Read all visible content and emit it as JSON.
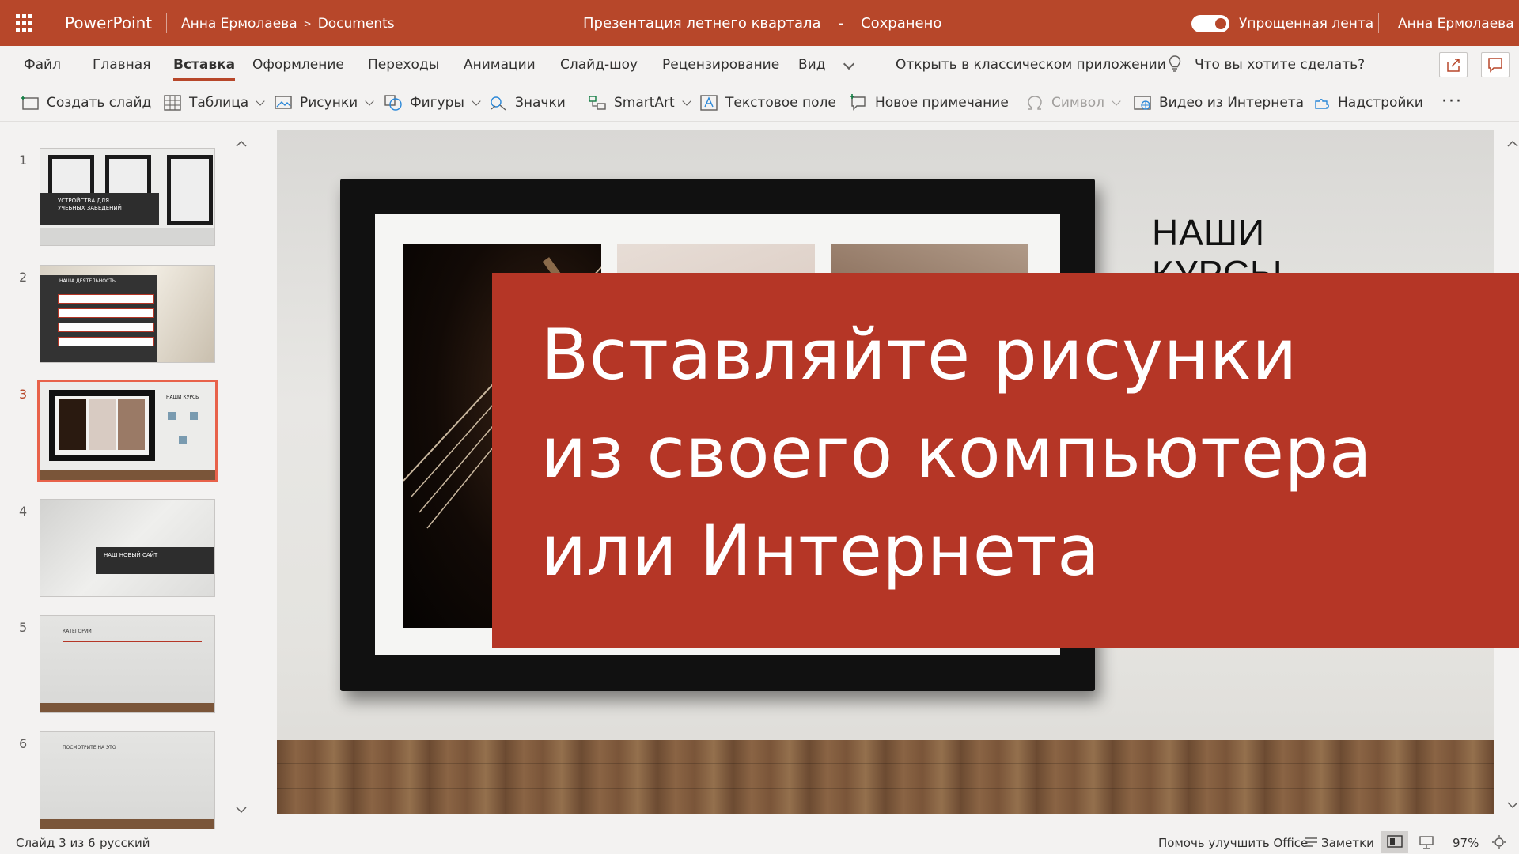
{
  "titlebar": {
    "app_name": "PowerPoint",
    "breadcrumb_user": "Анна Ермолаева",
    "breadcrumb_folder": "Documents",
    "doc_title": "Презентация летнего квартала",
    "doc_dash": "-",
    "save_status": "Сохранено",
    "toggle_label": "Упрощенная лента",
    "toggle_on": true,
    "user_name": "Анна Ермолаева"
  },
  "tabs": [
    "Файл",
    "Главная",
    "Вставка",
    "Оформление",
    "Переходы",
    "Анимации",
    "Слайд-шоу",
    "Рецензирование",
    "Вид"
  ],
  "active_tab": "Вставка",
  "open_desktop": "Открыть в классическом приложении",
  "tell_me": "Что вы хотите сделать?",
  "commands": {
    "new_slide": "Создать слайд",
    "table": "Таблица",
    "pictures": "Рисунки",
    "shapes": "Фигуры",
    "icons": "Значки",
    "smartart": "SmartArt",
    "textbox": "Текстовое поле",
    "new_comment": "Новое примечание",
    "symbol": "Символ",
    "online_video": "Видео из Интернета",
    "addins": "Надстройки",
    "more": "···"
  },
  "thumbnails": [
    {
      "num": "1",
      "text": "УСТРОЙСТВА ДЛЯ УЧЕБНЫХ ЗАВЕДЕНИЙ"
    },
    {
      "num": "2",
      "text": "НАША ДЕЯТЕЛЬНОСТЬ"
    },
    {
      "num": "3",
      "text": "НАШИ КУРСЫ"
    },
    {
      "num": "4",
      "text": "НАШ НОВЫЙ САЙТ"
    },
    {
      "num": "5",
      "text": "КАТЕГОРИИ"
    },
    {
      "num": "6",
      "text": "ПОСМОТРИТЕ НА ЭТО"
    }
  ],
  "selected_slide": 3,
  "slide": {
    "title": "НАШИ КУРСЫ"
  },
  "overlay": {
    "line1": "Вставляйте рисунки",
    "line2": "из своего компьютера",
    "line3": "или Интернета"
  },
  "status": {
    "slide_info": "Слайд 3 из 6",
    "language": "русский",
    "feedback": "Помочь улучшить Office",
    "notes": "Заметки",
    "zoom": "97%"
  },
  "colors": {
    "accent": "#b7472a",
    "overlay": "#b53626"
  }
}
